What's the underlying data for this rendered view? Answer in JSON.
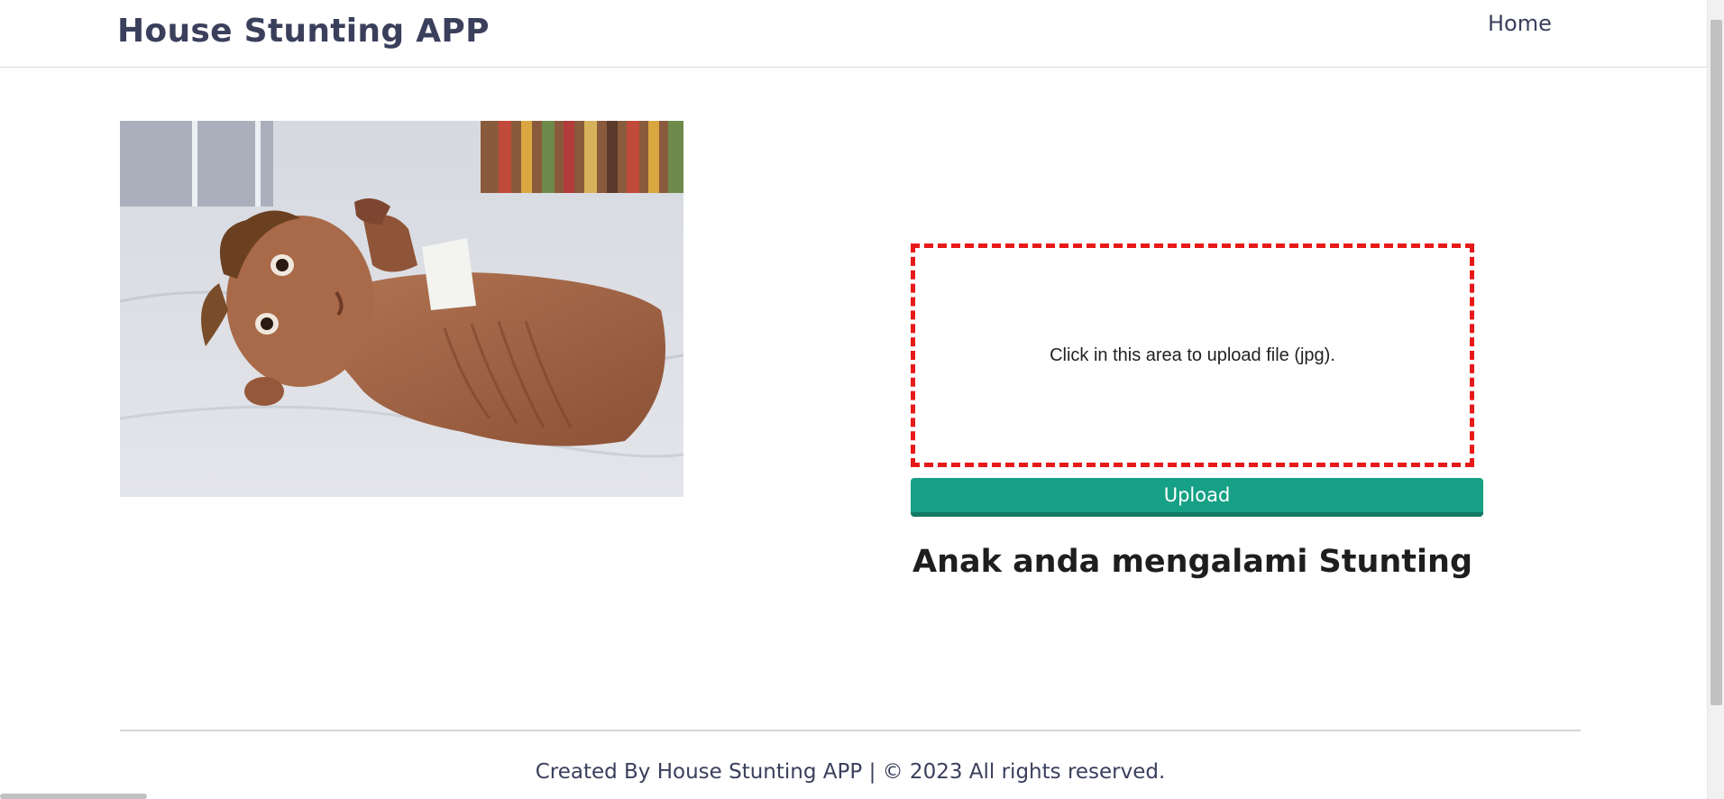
{
  "navbar": {
    "brand": "House Stunting APP",
    "home_link": "Home"
  },
  "photo": {
    "alt": "Photo of a malnourished child lying on a hospital bed"
  },
  "upload": {
    "dropzone_text": "Click in this area to upload file (jpg).",
    "button_label": "Upload"
  },
  "result": {
    "text": "Anak anda mengalami Stunting"
  },
  "footer": {
    "text": "Created By House Stunting APP | © 2023 All rights reserved."
  },
  "colors": {
    "brand_text": "#3a3f5c",
    "upload_button": "#16a085",
    "dropzone_border": "#e81919"
  }
}
